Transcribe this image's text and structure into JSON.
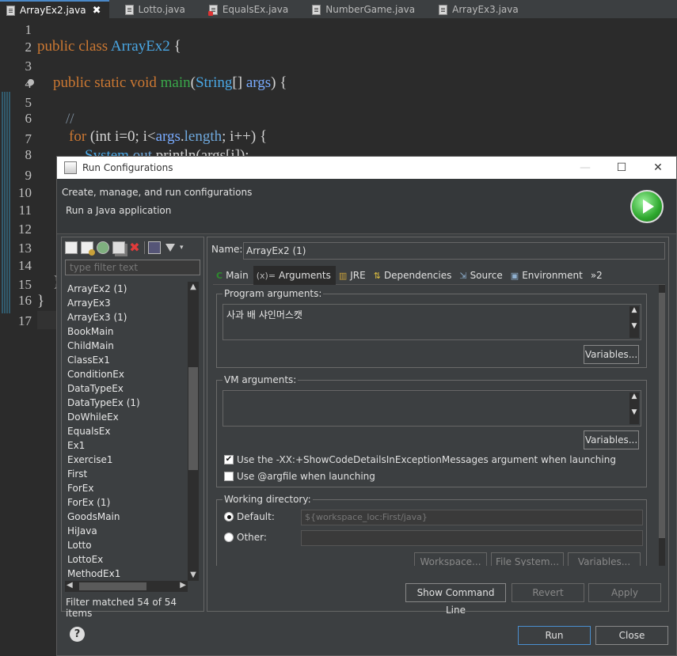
{
  "editor_tabs": [
    {
      "label": "ArrayEx2.java",
      "active": true,
      "close": "✖"
    },
    {
      "label": "Lotto.java"
    },
    {
      "label": "EqualsEx.java",
      "error": true
    },
    {
      "label": "NumberGame.java"
    },
    {
      "label": "ArrayEx3.java"
    }
  ],
  "code": {
    "lines": [
      "1",
      "2",
      "3",
      "4",
      "5",
      "6",
      "7",
      "8",
      "9",
      "10",
      "11",
      "12",
      "13",
      "14",
      "15",
      "16",
      "17"
    ],
    "l2": {
      "a": "public class ",
      "b": "ArrayEx2",
      "c": " {"
    },
    "l4": {
      "a": "public static void ",
      "b": "main",
      "c": "(",
      "d": "String",
      "e": "[] ",
      "f": "args",
      "g": ") {"
    },
    "l6": "//",
    "l7": {
      "a": "for ",
      "b": "(int ",
      "c": "i=0; i<",
      "d": "args",
      "e": ".",
      "f": "length",
      "g": "; i++) {"
    },
    "l8": {
      "a": "System",
      "b": ".",
      "c": "out",
      "d": ".println(args[i]);"
    },
    "l15": "}",
    "l16": "}"
  },
  "dialog": {
    "title": "Run Configurations",
    "title_buttons": [
      "—",
      "☐",
      "✕"
    ],
    "header_title": "Create, manage, and run configurations",
    "header_subtitle": "Run a Java application",
    "filter_placeholder": "type filter text",
    "configs": [
      "ArrayEx2 (1)",
      "ArrayEx3",
      "ArrayEx3 (1)",
      "BookMain",
      "ChildMain",
      "ClassEx1",
      "ConditionEx",
      "DataTypeEx",
      "DataTypeEx (1)",
      "DoWhileEx",
      "EqualsEx",
      "Ex1",
      "Exercise1",
      "First",
      "ForEx",
      "ForEx (1)",
      "GoodsMain",
      "HiJava",
      "Lotto",
      "LottoEx",
      "MethodEx1"
    ],
    "filter_status": "Filter matched 54 of 54 items",
    "name_label": "Name:",
    "name_value": "ArrayEx2 (1)",
    "tabs": [
      "Main",
      "Arguments",
      "JRE",
      "Dependencies",
      "Source",
      "Environment",
      "»2"
    ],
    "program_args_label": "Program arguments:",
    "program_args_value": "사과 배 샤인머스캣",
    "variables_label": "Variables...",
    "vm_args_label": "VM arguments:",
    "vm_args_value": "",
    "check_showcode": "Use the -XX:+ShowCodeDetailsInExceptionMessages argument when launching",
    "check_argfile": "Use @argfile when launching",
    "working_dir_label": "Working directory:",
    "default_label": "Default:",
    "default_value": "${workspace_loc:First/java}",
    "other_label": "Other:",
    "workspace_btn": "Workspace...",
    "filesystem_btn": "File System...",
    "variables_btn3": "Variables...",
    "show_cmd_btn": "Show Command Line",
    "revert_btn": "Revert",
    "apply_btn": "Apply",
    "run_btn": "Run",
    "close_btn": "Close",
    "help": "?"
  }
}
